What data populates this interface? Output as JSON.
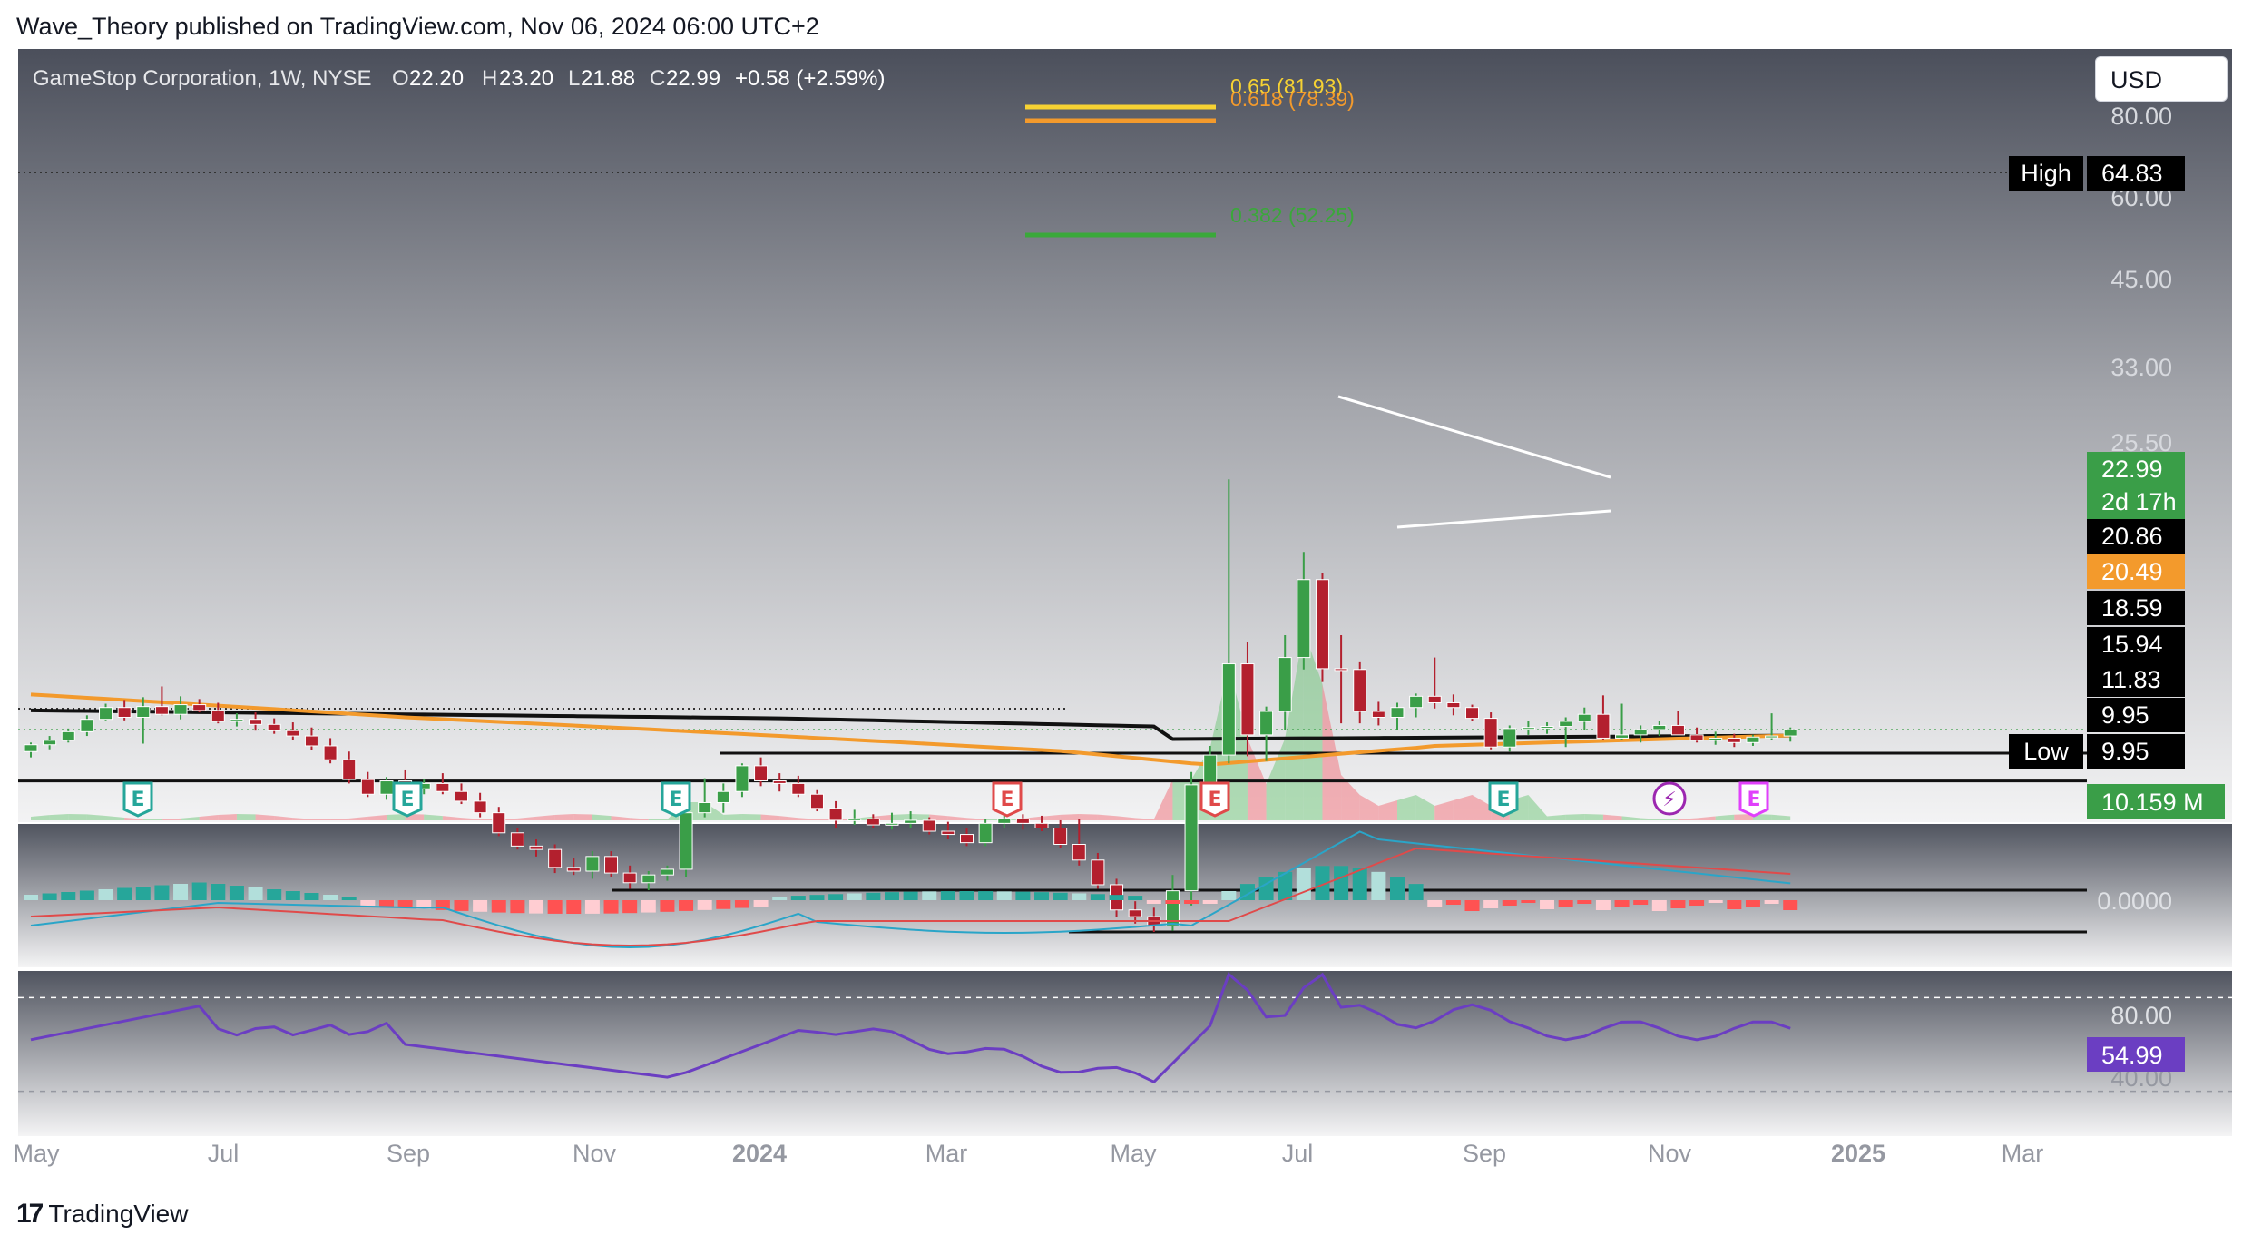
{
  "publisher_line": "Wave_Theory published on TradingView.com, Nov 06, 2024 06:00 UTC+2",
  "brand": "TradingView",
  "currency_button": "USD",
  "header": {
    "symbol": "GameStop Corporation, 1W, NYSE",
    "o_label": "O",
    "o_value": "22.20",
    "h_label": "H",
    "h_value": "23.20",
    "l_label": "L",
    "l_value": "21.88",
    "c_label": "C",
    "c_value": "22.99",
    "change": "+0.58 (+2.59%)"
  },
  "colors": {
    "up": "#3a9e48",
    "down": "#b3202e",
    "sma200": "#111111",
    "sma100": "#f39a2c",
    "macd": "#2aa5c8",
    "signal": "#e04a4a",
    "rsi": "#6b3ec2",
    "fib065": "#f6d233",
    "fib0618": "#f39a2c",
    "fib0382": "#3aa83a",
    "earnings_green": "#26a69a",
    "earnings_red": "#e04a4a",
    "earnings_magenta": "#e040fb",
    "price_badge": "#3a9e48",
    "sma_badge": "#f39a2c",
    "volume_badge": "#3a9e48"
  },
  "chart_data": {
    "type": "candlestick",
    "timeframe": "1W",
    "scale": "log",
    "x_axis_ticks": [
      "May",
      "Jul",
      "Sep",
      "Nov",
      "2024",
      "Mar",
      "May",
      "Jul",
      "Sep",
      "Nov",
      "2025",
      "Mar"
    ],
    "y_axis_ticks": [
      "80.00",
      "60.00",
      "45.00",
      "33.00",
      "25.50"
    ],
    "price_labels": [
      {
        "label": "High",
        "value": "64.83"
      },
      {
        "label": "",
        "value": "22.99",
        "sub": "2d 17h"
      },
      {
        "label": "",
        "value": "20.86"
      },
      {
        "label": "",
        "value": "20.49"
      },
      {
        "label": "",
        "value": "18.59"
      },
      {
        "label": "",
        "value": "15.94"
      },
      {
        "label": "",
        "value": "11.83"
      },
      {
        "label": "",
        "value": "9.95"
      },
      {
        "label": "Low",
        "value": "9.95"
      }
    ],
    "horizontal_levels": [
      20.86,
      18.59,
      11.83,
      9.95
    ],
    "fib_levels": [
      {
        "label": "0.65 (81.93)",
        "value": 81.93
      },
      {
        "label": "0.618 (78.39)",
        "value": 78.39
      },
      {
        "label": "0.382 (52.25)",
        "value": 52.25
      }
    ],
    "candles": [
      [
        21.0,
        21.8,
        20.5,
        21.6
      ],
      [
        21.6,
        22.4,
        21.2,
        22.0
      ],
      [
        22.0,
        23.1,
        21.8,
        22.8
      ],
      [
        22.8,
        24.4,
        22.4,
        24.0
      ],
      [
        24.0,
        25.6,
        23.8,
        25.2
      ],
      [
        25.2,
        26.0,
        23.9,
        24.2
      ],
      [
        24.2,
        26.3,
        21.7,
        25.3
      ],
      [
        25.3,
        27.5,
        24.4,
        24.5
      ],
      [
        24.5,
        26.4,
        24.0,
        25.5
      ],
      [
        25.5,
        26.1,
        24.7,
        24.9
      ],
      [
        24.9,
        25.7,
        23.6,
        23.8
      ],
      [
        23.8,
        24.6,
        23.3,
        24.0
      ],
      [
        24.0,
        24.7,
        22.9,
        23.5
      ],
      [
        23.5,
        24.1,
        22.6,
        22.9
      ],
      [
        22.9,
        23.7,
        22.0,
        22.4
      ],
      [
        22.4,
        23.2,
        21.1,
        21.5
      ],
      [
        21.5,
        22.2,
        20.0,
        20.3
      ],
      [
        20.3,
        21.0,
        18.4,
        18.7
      ],
      [
        18.7,
        19.3,
        17.4,
        17.6
      ],
      [
        17.6,
        18.9,
        17.2,
        18.6
      ],
      [
        18.6,
        19.5,
        17.9,
        18.0
      ],
      [
        18.0,
        18.7,
        17.6,
        18.4
      ],
      [
        18.4,
        19.2,
        17.6,
        17.8
      ],
      [
        17.8,
        18.4,
        16.9,
        17.1
      ],
      [
        17.1,
        17.7,
        16.0,
        16.3
      ],
      [
        16.3,
        16.7,
        14.8,
        15.0
      ],
      [
        15.0,
        15.3,
        14.0,
        14.2
      ],
      [
        14.2,
        14.6,
        13.6,
        14.0
      ],
      [
        14.0,
        14.3,
        12.7,
        13.0
      ],
      [
        13.0,
        13.5,
        12.6,
        12.8
      ],
      [
        12.8,
        13.9,
        12.4,
        13.6
      ],
      [
        13.6,
        13.9,
        12.5,
        12.7
      ],
      [
        12.7,
        13.1,
        11.9,
        12.2
      ],
      [
        12.2,
        12.8,
        11.83,
        12.6
      ],
      [
        12.6,
        13.1,
        12.3,
        12.9
      ],
      [
        12.9,
        16.8,
        12.5,
        16.3
      ],
      [
        16.3,
        18.8,
        16.0,
        17.0
      ],
      [
        17.0,
        18.4,
        16.3,
        17.8
      ],
      [
        17.8,
        20.0,
        17.4,
        19.8
      ],
      [
        19.8,
        20.5,
        18.2,
        18.6
      ],
      [
        18.6,
        19.2,
        17.8,
        18.4
      ],
      [
        18.4,
        19.0,
        17.4,
        17.6
      ],
      [
        17.6,
        17.9,
        16.4,
        16.6
      ],
      [
        16.6,
        17.1,
        15.3,
        15.8
      ],
      [
        15.8,
        16.5,
        15.5,
        15.9
      ],
      [
        15.9,
        16.2,
        15.3,
        15.5
      ],
      [
        15.5,
        16.3,
        15.2,
        15.6
      ],
      [
        15.6,
        16.4,
        15.3,
        15.8
      ],
      [
        15.8,
        16.0,
        14.9,
        15.1
      ],
      [
        15.1,
        15.7,
        14.6,
        14.9
      ],
      [
        14.9,
        15.3,
        14.2,
        14.4
      ],
      [
        14.4,
        15.9,
        14.2,
        15.6
      ],
      [
        15.6,
        16.4,
        15.3,
        15.9
      ],
      [
        15.9,
        16.2,
        15.2,
        15.6
      ],
      [
        15.6,
        16.1,
        15.1,
        15.3
      ],
      [
        15.3,
        15.8,
        14.1,
        14.3
      ],
      [
        14.3,
        15.9,
        13.1,
        13.4
      ],
      [
        13.4,
        13.8,
        11.9,
        12.1
      ],
      [
        12.1,
        12.4,
        10.6,
        10.9
      ],
      [
        10.9,
        11.3,
        10.3,
        10.6
      ],
      [
        10.6,
        11.0,
        9.95,
        10.2
      ],
      [
        10.2,
        12.6,
        10.0,
        11.8
      ],
      [
        11.8,
        19.3,
        11.1,
        18.3
      ],
      [
        18.3,
        21.5,
        16.4,
        20.7
      ],
      [
        20.7,
        64.83,
        20.0,
        30.2
      ],
      [
        30.2,
        33.0,
        20.6,
        22.5
      ],
      [
        22.5,
        25.3,
        20.2,
        24.8
      ],
      [
        24.8,
        34.0,
        23.0,
        31.0
      ],
      [
        31.0,
        48.0,
        29.5,
        42.8
      ],
      [
        42.8,
        44.0,
        28.0,
        29.6
      ],
      [
        29.6,
        34.0,
        23.6,
        29.5
      ],
      [
        29.5,
        30.5,
        23.6,
        24.8
      ],
      [
        24.8,
        25.8,
        23.4,
        24.2
      ],
      [
        24.2,
        25.7,
        23.0,
        25.2
      ],
      [
        25.2,
        26.7,
        24.2,
        26.4
      ],
      [
        26.4,
        31.0,
        25.1,
        25.7
      ],
      [
        25.7,
        26.6,
        24.4,
        25.2
      ],
      [
        25.2,
        25.5,
        23.8,
        24.1
      ],
      [
        24.1,
        24.7,
        21.2,
        21.4
      ],
      [
        21.4,
        23.4,
        21.0,
        23.1
      ],
      [
        23.1,
        23.8,
        22.5,
        23.2
      ],
      [
        23.2,
        23.7,
        22.6,
        23.3
      ],
      [
        23.3,
        24.2,
        21.4,
        23.8
      ],
      [
        23.8,
        25.2,
        23.0,
        24.5
      ],
      [
        24.5,
        26.5,
        22.0,
        22.2
      ],
      [
        22.2,
        25.6,
        22.0,
        22.5
      ],
      [
        22.5,
        23.4,
        21.8,
        23.0
      ],
      [
        23.0,
        23.8,
        22.4,
        23.4
      ],
      [
        23.4,
        24.8,
        22.6,
        22.5
      ],
      [
        22.5,
        23.2,
        21.8,
        22.0
      ],
      [
        22.0,
        22.8,
        21.6,
        22.2
      ],
      [
        22.2,
        22.6,
        21.4,
        21.8
      ],
      [
        21.8,
        22.5,
        21.5,
        22.3
      ],
      [
        22.3,
        24.6,
        22.0,
        22.4
      ],
      [
        22.4,
        23.2,
        21.88,
        22.99
      ]
    ],
    "volume_label": "10.159 M",
    "earnings_markers": [
      {
        "label": "E",
        "kind": "green"
      },
      {
        "label": "E",
        "kind": "green"
      },
      {
        "label": "E",
        "kind": "green"
      },
      {
        "label": "E",
        "kind": "red"
      },
      {
        "label": "E",
        "kind": "red"
      },
      {
        "label": "E",
        "kind": "green"
      },
      {
        "label": "⚡",
        "kind": "lightning"
      },
      {
        "label": "E",
        "kind": "magenta"
      }
    ],
    "macd": {
      "zero_label": "0.0000"
    },
    "rsi": {
      "ticks": [
        "80.00",
        "40.00"
      ],
      "value": "54.99",
      "upper": 70,
      "lower": 30
    }
  }
}
